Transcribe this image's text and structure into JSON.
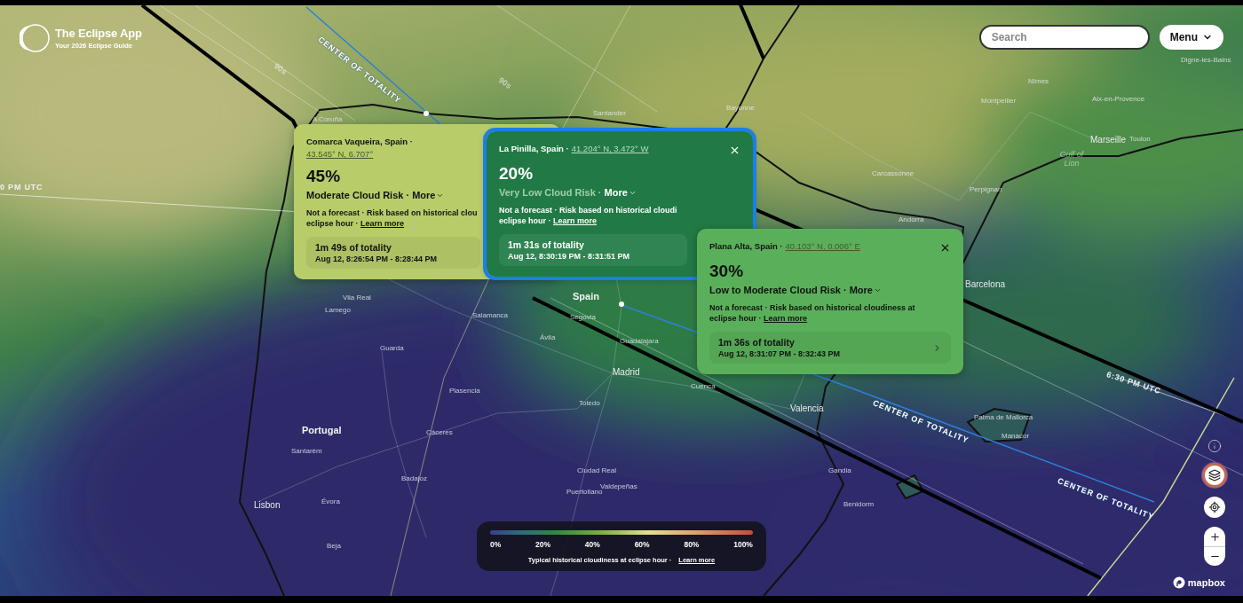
{
  "header": {
    "app_title": "The Eclipse App",
    "tagline": "Your 2026 Eclipse Guide"
  },
  "search": {
    "placeholder": "Search"
  },
  "menu_button": {
    "label": "Menu"
  },
  "map_labels": [
    {
      "text": "CENTER OF TOTALITY",
      "kind": "path"
    },
    {
      "text": "CENTER OF TOTALITY",
      "kind": "path"
    },
    {
      "text": "CENTER OF TOTALITY",
      "kind": "path"
    },
    {
      "text": "0 PM UTC",
      "kind": "time"
    },
    {
      "text": "6:30 PM UTC",
      "kind": "time"
    },
    {
      "text": "90s",
      "kind": "duration"
    },
    {
      "text": "90s",
      "kind": "duration"
    },
    {
      "text": "Madrid",
      "kind": "major"
    },
    {
      "text": "Spain",
      "kind": "country"
    },
    {
      "text": "Portugal",
      "kind": "country"
    },
    {
      "text": "Valencia",
      "kind": "major"
    },
    {
      "text": "Barcelona",
      "kind": "major"
    },
    {
      "text": "Lisbon",
      "kind": "major"
    },
    {
      "text": "Marseille",
      "kind": "major"
    },
    {
      "text": "Carcassonne",
      "kind": "city"
    },
    {
      "text": "Perpignan",
      "kind": "city"
    },
    {
      "text": "Andorra",
      "kind": "city"
    },
    {
      "text": "Montpellier",
      "kind": "city"
    },
    {
      "text": "Nîmes",
      "kind": "city"
    },
    {
      "text": "Toulon",
      "kind": "city"
    },
    {
      "text": "Aix-en-Provence",
      "kind": "city"
    },
    {
      "text": "Digne-les-Bains",
      "kind": "city"
    },
    {
      "text": "Bayonne",
      "kind": "city"
    },
    {
      "text": "Santander",
      "kind": "city"
    },
    {
      "text": "A Coruña",
      "kind": "city"
    },
    {
      "text": "Gulf of Lion",
      "kind": "sea"
    },
    {
      "text": "Salamanca",
      "kind": "city"
    },
    {
      "text": "Segovia",
      "kind": "city"
    },
    {
      "text": "Ávila",
      "kind": "city"
    },
    {
      "text": "Guadalajara",
      "kind": "city"
    },
    {
      "text": "Cuenca",
      "kind": "city"
    },
    {
      "text": "Toledo",
      "kind": "city"
    },
    {
      "text": "Cáceres",
      "kind": "city"
    },
    {
      "text": "Badajoz",
      "kind": "city"
    },
    {
      "text": "Évora",
      "kind": "city"
    },
    {
      "text": "Beja",
      "kind": "city"
    },
    {
      "text": "Santarém",
      "kind": "city"
    },
    {
      "text": "Ciudad Real",
      "kind": "city"
    },
    {
      "text": "Puertollano",
      "kind": "city"
    },
    {
      "text": "Valdepeñas",
      "kind": "city"
    },
    {
      "text": "Plasencia",
      "kind": "city"
    },
    {
      "text": "Guarda",
      "kind": "city"
    },
    {
      "text": "Lamego",
      "kind": "city"
    },
    {
      "text": "Vila Real",
      "kind": "city"
    },
    {
      "text": "Palma de Mallorca",
      "kind": "city"
    },
    {
      "text": "Manacor",
      "kind": "city"
    },
    {
      "text": "Benidorm",
      "kind": "city"
    },
    {
      "text": "Gandia",
      "kind": "city"
    }
  ],
  "popups": [
    {
      "place": "Comarca Vaqueira, Spain ·",
      "coordinates": "43.545° N, 6.707°",
      "percent": "45%",
      "risk": "Moderate Cloud Risk ·",
      "more": "More",
      "note": "Not a forecast · Risk based on historical clou",
      "note_end": "eclipse hour ·",
      "link": "Learn more",
      "duration": "1m 49s of totality",
      "times": "Aug 12, 8:26:54 PM - 8:28:44 PM",
      "color": "#b8cc6a",
      "kind": "light",
      "selected": false,
      "has_close": false,
      "has_chevron": false
    },
    {
      "place": "La Pinilla, Spain ·",
      "coordinates": "41.204° N, 3.472° W",
      "percent": "20%",
      "risk": "Very Low Cloud Risk ·",
      "more": "More",
      "note": "Not a forecast · Risk based on historical cloudi",
      "note_end": "eclipse hour ·",
      "link": "Learn more",
      "duration": "1m 31s of totality",
      "times": "Aug 12, 8:30:19 PM - 8:31:51 PM",
      "color": "#217a45",
      "kind": "dark",
      "selected": true,
      "has_close": true,
      "has_chevron": false
    },
    {
      "place": "Plana Alta, Spain ·",
      "coordinates": "40.103° N, 0.006° E",
      "percent": "30%",
      "risk": "Low to Moderate Cloud Risk ·",
      "more": "More",
      "note": "Not a forecast · Risk based on historical cloudiness at",
      "note_end": "eclipse hour ·",
      "link": "Learn more",
      "duration": "1m 36s of totality",
      "times": "Aug 12, 8:31:07 PM - 8:32:43 PM",
      "color": "#5ab05a",
      "kind": "light",
      "selected": false,
      "has_close": true,
      "has_chevron": true
    }
  ],
  "legend": {
    "ticks": [
      "0%",
      "20%",
      "40%",
      "60%",
      "80%",
      "100%"
    ],
    "caption": "Typical historical cloudiness at eclipse hour ·",
    "link": "Learn more"
  },
  "attribution": {
    "label": "mapbox"
  }
}
